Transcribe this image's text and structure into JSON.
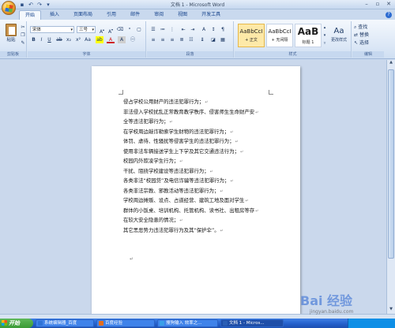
{
  "window": {
    "title": "文档 1 - Microsoft Word"
  },
  "ribbon": {
    "tabs": [
      "开始",
      "插入",
      "页面布局",
      "引用",
      "邮件",
      "审阅",
      "视图",
      "开发工具"
    ],
    "active_tab": "开始",
    "clipboard": {
      "paste_label": "粘贴",
      "group_label": "剪贴板"
    },
    "font": {
      "name": "宋体",
      "size": "三号",
      "group_label": "字体"
    },
    "paragraph": {
      "group_label": "段落"
    },
    "styles": {
      "items": [
        {
          "sample": "AaBbCcI",
          "name": "+ 正文"
        },
        {
          "sample": "AaBbCcI",
          "name": "+ 无间隔"
        },
        {
          "sample": "AaB",
          "name": "标题 1"
        }
      ],
      "change_styles_label": "更改样式",
      "group_label": "样式"
    },
    "editing": {
      "find_label": "查找",
      "replace_label": "替换",
      "select_label": "选择",
      "group_label": "编辑"
    }
  },
  "document": {
    "lines": [
      "侵占学校公用财产的违法犯罪行为；",
      "非法侵入学校扰乱正常教育教学秩序、侵害师生生命财产安",
      "全等违法犯罪行为；",
      "在学校周边敲诈勒索学生财物的违法犯罪行为；",
      "体罚、虐待、性骚扰等侵害学生的违法犯罪行为；",
      "使用非法车辆接送学生上下学及其它交通违法行为；",
      "校园内外欺凌学生行为；",
      "干扰、阻挠学校建设等违法犯罪行为；",
      "各类非法“校园贷”及电信诈骗等违法犯罪行为；",
      "各类非法宗教、邪教活动等违法犯罪行为；",
      "学校周边摊贩、设点、占道经营、建筑工地及面对学生",
      "群体的小饭桌、培训机构、托管机构、读书社、出租房等存",
      "在较大安全隐患的情况；",
      "其它黑恶势力违法犯罪行为及其“保护伞”。"
    ]
  },
  "taskbar": {
    "start_label": "开始",
    "tasks": [
      {
        "label": "系统编辑器_百度",
        "color": "#2f73d6"
      },
      {
        "label": "百度经验",
        "color": "#e36d1d"
      },
      {
        "label": "搜狗输入 效率之...",
        "color": "#3aa0e8"
      },
      {
        "label": "文档 1 - Micros...",
        "color": "#2b5fb5"
      }
    ]
  },
  "watermark": {
    "logo": "Bai 经验",
    "sub": "jingyan.baidu.com"
  }
}
